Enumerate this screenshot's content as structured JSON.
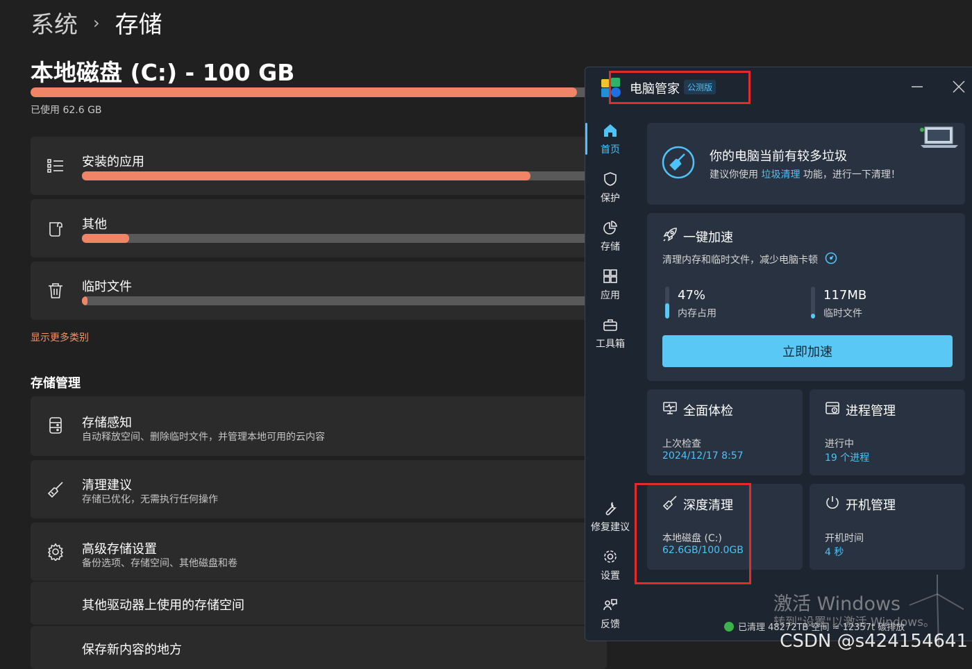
{
  "settings": {
    "breadcrumb": {
      "parent": "系统",
      "sep": "›",
      "current": "存储"
    },
    "disk_title": "本地磁盘 (C:) - 100 GB",
    "disk_used_fraction": 0.96,
    "disk_used_text": "已使用 62.6 GB",
    "categories": [
      {
        "label": "安装的应用",
        "icon": "list-icon",
        "fraction": 0.85
      },
      {
        "label": "其他",
        "icon": "document-icon",
        "fraction": 0.09
      },
      {
        "label": "临时文件",
        "icon": "trash-icon",
        "fraction": 0.01
      }
    ],
    "more_link": "显示更多类别",
    "section_title": "存储管理",
    "management": [
      {
        "label": "存储感知",
        "desc": "自动释放空间、删除临时文件，并管理本地可用的云内容",
        "icon": "storage-sense-icon"
      },
      {
        "label": "清理建议",
        "desc": "存储已优化，无需执行任何操作",
        "icon": "broom-icon"
      },
      {
        "label": "高级存储设置",
        "desc": "备份选项、存储空间、其他磁盘和卷",
        "icon": "gear-icon"
      },
      {
        "label": "其他驱动器上使用的存储空间",
        "desc": "",
        "icon": ""
      },
      {
        "label": "保存新内容的地方",
        "desc": "",
        "icon": ""
      }
    ]
  },
  "manager": {
    "title": "电脑管家",
    "badge": "公测版",
    "nav": [
      {
        "label": "首页",
        "icon": "home-icon",
        "active": true
      },
      {
        "label": "保护",
        "icon": "shield-icon",
        "active": false
      },
      {
        "label": "存储",
        "icon": "pie-icon",
        "active": false
      },
      {
        "label": "应用",
        "icon": "apps-icon",
        "active": false
      },
      {
        "label": "工具箱",
        "icon": "toolbox-icon",
        "active": false
      },
      {
        "label": "修复建议",
        "icon": "wrench-icon",
        "active": false
      },
      {
        "label": "设置",
        "icon": "gear-icon",
        "active": false
      },
      {
        "label": "反馈",
        "icon": "feedback-icon",
        "active": false
      }
    ],
    "alert": {
      "title": "你的电脑当前有较多垃圾",
      "desc_pre": "建议你使用",
      "desc_link": "垃圾清理",
      "desc_post": "功能，进行一下清理！"
    },
    "boost": {
      "title": "一键加速",
      "desc": "清理内存和临时文件，减少电脑卡顿",
      "memory_value": "47%",
      "memory_label": "内存占用",
      "memory_fraction": 0.47,
      "temp_value": "117MB",
      "temp_label": "临时文件",
      "temp_fraction": 0.15,
      "button": "立即加速"
    },
    "checkup": {
      "title": "全面体检",
      "label": "上次检查",
      "value": "2024/12/17 8:57"
    },
    "process": {
      "title": "进程管理",
      "label": "进行中",
      "value": "19 个进程"
    },
    "deepclean": {
      "title": "深度清理",
      "label": "本地磁盘 (C:)",
      "value": "62.6GB/100.0GB"
    },
    "startup": {
      "title": "开机管理",
      "label": "开机时间",
      "value": "4 秒"
    },
    "status": "已清理 48272TB 空间 ≈ 12357t 碳排放"
  },
  "watermarks": {
    "activate_title": "激活 Windows",
    "activate_desc": "转到\"设置\"以激活 Windows。",
    "csdn": "CSDN @s424154641"
  },
  "colors": {
    "accent": "#4fc3f7",
    "bar": "#f08467",
    "highlight_box": "#e22b2b"
  }
}
